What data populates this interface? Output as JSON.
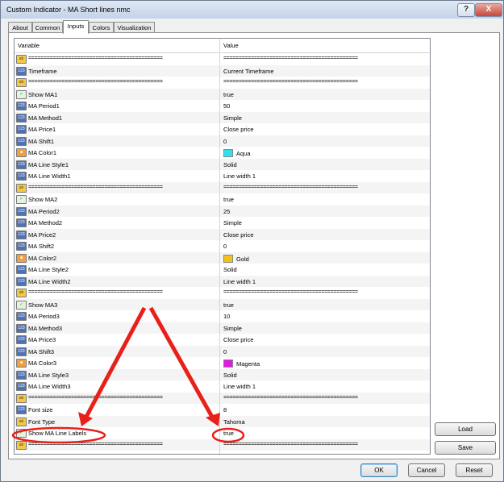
{
  "window": {
    "title": "Custom Indicator - MA Short lines nmc",
    "help_label": "?",
    "close_label": "X"
  },
  "tabs": [
    "About",
    "Common",
    "Inputs",
    "Colors",
    "Visualization"
  ],
  "table": {
    "headers": [
      "Variable",
      "Value"
    ],
    "rows": [
      {
        "icon": "ab",
        "dashes": true
      },
      {
        "icon": "int",
        "label": "Timeframe",
        "value": "Current Timeframe"
      },
      {
        "icon": "ab",
        "dashes": true
      },
      {
        "icon": "bool",
        "label": "Show MA1",
        "value": "true"
      },
      {
        "icon": "int",
        "label": "MA Period1",
        "value": "50"
      },
      {
        "icon": "int",
        "label": "MA Method1",
        "value": "Simple"
      },
      {
        "icon": "int",
        "label": "MA Price1",
        "value": "Close price"
      },
      {
        "icon": "int",
        "label": "MA Shift1",
        "value": "0"
      },
      {
        "icon": "color",
        "label": "MA Color1",
        "value": "Aqua",
        "swatch": "#33e0e8"
      },
      {
        "icon": "int",
        "label": "MA Line Style1",
        "value": "Solid"
      },
      {
        "icon": "int",
        "label": "MA Line Width1",
        "value": "Line width 1"
      },
      {
        "icon": "ab",
        "dashes": true
      },
      {
        "icon": "bool",
        "label": "Show MA2",
        "value": "true"
      },
      {
        "icon": "int",
        "label": "MA Period2",
        "value": "25"
      },
      {
        "icon": "int",
        "label": "MA Method2",
        "value": "Simple"
      },
      {
        "icon": "int",
        "label": "MA Price2",
        "value": "Close price"
      },
      {
        "icon": "int",
        "label": "MA Shift2",
        "value": "0"
      },
      {
        "icon": "color",
        "label": "MA Color2",
        "value": "Gold",
        "swatch": "#f2c21a"
      },
      {
        "icon": "int",
        "label": "MA Line Style2",
        "value": "Solid"
      },
      {
        "icon": "int",
        "label": "MA Line Width2",
        "value": "Line width 1"
      },
      {
        "icon": "ab",
        "dashes": true
      },
      {
        "icon": "bool",
        "label": "Show MA3",
        "value": "true"
      },
      {
        "icon": "int",
        "label": "MA Period3",
        "value": "10"
      },
      {
        "icon": "int",
        "label": "MA Method3",
        "value": "Simple"
      },
      {
        "icon": "int",
        "label": "MA Price3",
        "value": "Close price"
      },
      {
        "icon": "int",
        "label": "MA Shift3",
        "value": "0"
      },
      {
        "icon": "color",
        "label": "MA Color3",
        "value": "Magenta",
        "swatch": "#e01ae0"
      },
      {
        "icon": "int",
        "label": "MA Line Style3",
        "value": "Solid"
      },
      {
        "icon": "int",
        "label": "MA Line Width3",
        "value": "Line width 1"
      },
      {
        "icon": "ab",
        "dashes": true
      },
      {
        "icon": "int",
        "label": "Font size",
        "value": "8"
      },
      {
        "icon": "ab",
        "label": "Font Type",
        "value": "Tahoma"
      },
      {
        "icon": "bool",
        "label": "Show MA Line Labels",
        "value": "true"
      },
      {
        "icon": "ab",
        "dashes": true
      }
    ]
  },
  "dash_text": "============================================",
  "side_buttons": {
    "load": "Load",
    "save": "Save"
  },
  "bottom_buttons": {
    "ok": "OK",
    "cancel": "Cancel",
    "reset": "Reset"
  },
  "annotation_color": "#e8201a"
}
